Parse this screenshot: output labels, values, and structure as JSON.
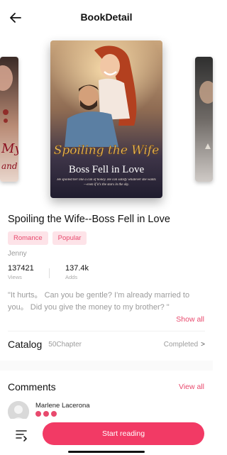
{
  "header": {
    "title": "BookDetail",
    "back_icon": "arrow-left-icon"
  },
  "cover": {
    "title_line1": "Spoiling the Wife",
    "title_line2": "Boss Fell in Love",
    "blurb": "He spoiled her like a can of honey.   He can satisfy whatever she wants—even if it's the stars in the sky."
  },
  "side_cover_left": {
    "text_line1": "My",
    "text_line2": "and"
  },
  "book": {
    "title": "Spoiling the Wife--Boss Fell in Love",
    "tags": [
      "Romance",
      "Popular"
    ],
    "author": "Jenny",
    "views_value": "137421",
    "views_label": "Views",
    "adds_value": "137.4k",
    "adds_label": "Adds",
    "description": "\"It hurts。 Can you be gentle?  I'm already married to you。 Did you give the money to my brother? \"",
    "show_all_label": "Show all"
  },
  "catalog": {
    "title": "Catalog",
    "chapters": "50Chapter",
    "status": "Completed",
    "arrow": ">"
  },
  "comments": {
    "title": "Comments",
    "view_all_label": "View all",
    "items": [
      {
        "name": "Marlene Lacerona",
        "stars": 3
      }
    ]
  },
  "bottom": {
    "start_label": "Start reading",
    "menu_icon": "chapter-list-icon"
  },
  "colors": {
    "accent": "#f23a65",
    "tag_bg": "#fde3e8",
    "tag_text": "#e8496d"
  }
}
